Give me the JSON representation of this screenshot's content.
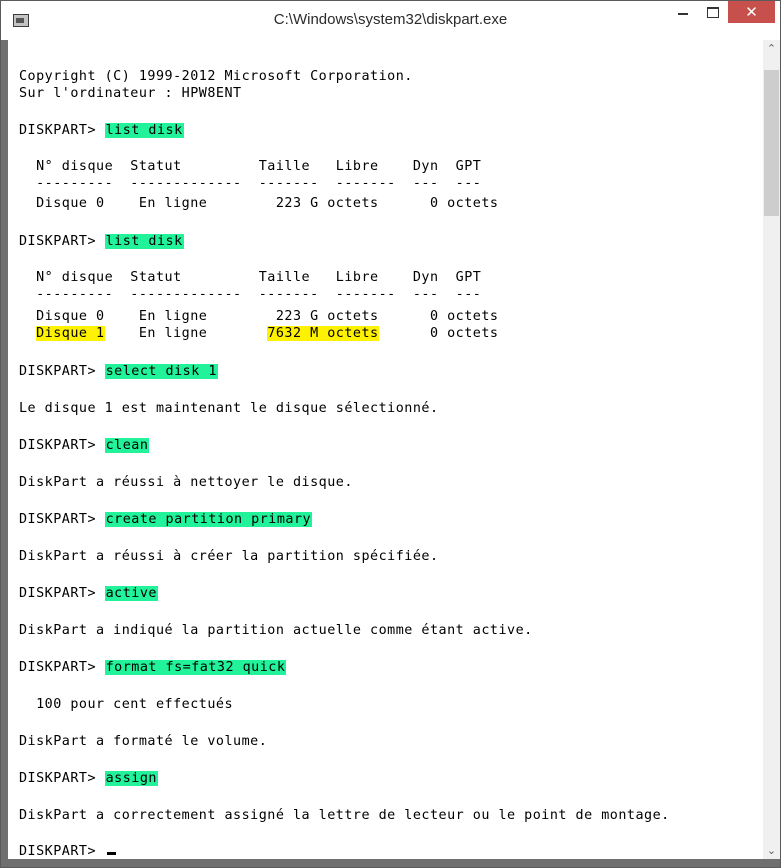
{
  "window": {
    "title": "C:\\Windows\\system32\\diskpart.exe",
    "minimize_label": "",
    "close_label": "✕"
  },
  "console": {
    "copyright": "Copyright (C) 1999-2012 Microsoft Corporation.",
    "computer": "Sur l'ordinateur : HPW8ENT",
    "prompt": "DISKPART> ",
    "cmd1": "list disk",
    "header": "  N° disque  Statut         Taille   Libre    Dyn  GPT",
    "separator": "  ---------  -------------  -------  -------  ---  ---",
    "disk0_row": "  Disque 0    En ligne        223 G octets      0 octets",
    "cmd2": "list disk",
    "header2": "  N° disque  Statut         Taille   Libre    Dyn  GPT",
    "separator2": "  ---------  -------------  -------  -------  ---  ---",
    "disk0_row2": "  Disque 0    En ligne        223 G octets      0 octets",
    "disk1_name": "Disque 1",
    "disk1_mid": "    En ligne       ",
    "disk1_size": "7632 M octets",
    "disk1_free": "      0 octets",
    "cmd3": "select disk 1",
    "msg3": "Le disque 1 est maintenant le disque sélectionné.",
    "cmd4": "clean",
    "msg4": "DiskPart a réussi à nettoyer le disque.",
    "cmd5": "create partition primary",
    "msg5": "DiskPart a réussi à créer la partition spécifiée.",
    "cmd6": "active",
    "msg6": "DiskPart a indiqué la partition actuelle comme étant active.",
    "cmd7": "format fs=fat32 quick",
    "msg7a": "  100 pour cent effectués",
    "msg7b": "DiskPart a formaté le volume.",
    "cmd8": "assign",
    "msg8": "DiskPart a correctement assigné la lettre de lecteur ou le point de montage.",
    "final_prompt": "DISKPART> "
  },
  "colors": {
    "command_highlight": "#22f29a",
    "selection_highlight": "#fff200",
    "close_button": "#c7504c"
  }
}
